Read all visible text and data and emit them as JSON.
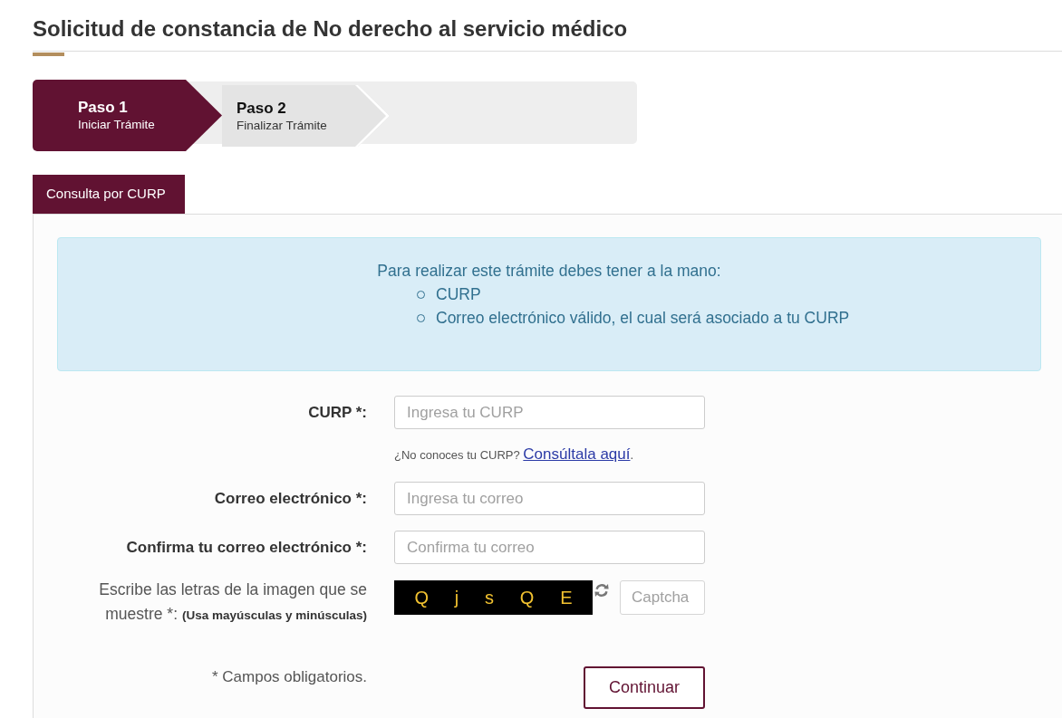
{
  "page": {
    "title": "Solicitud de constancia de No derecho al servicio médico"
  },
  "steps": [
    {
      "label": "Paso 1",
      "sublabel": "Iniciar Trámite",
      "selected": true
    },
    {
      "label": "Paso 2",
      "sublabel": "Finalizar Trámite",
      "selected": false
    }
  ],
  "tabs": [
    {
      "label": "Consulta por CURP",
      "selected": true
    }
  ],
  "notice": {
    "text": "Para realizar este trámite debes tener a la mano:",
    "items": [
      "CURP",
      "Correo electrónico válido, el cual será asociado a tu CURP"
    ]
  },
  "form": {
    "fields": [
      {
        "label": "CURP *:",
        "placeholder": "Ingresa tu CURP",
        "help": {
          "text": "¿No conoces tu CURP?",
          "link": "Consúltala aquí",
          "suffix": "."
        }
      },
      {
        "label": "Correo electrónico *:",
        "placeholder": "Ingresa tu correo"
      },
      {
        "label": "Confirma tu correo electrónico *:",
        "placeholder": "Confirma tu correo"
      }
    ],
    "captcha": {
      "label": "Escribe las letras de la imagen que se muestre *: **(Usa mayúsculas y minúsculas)**",
      "letters": [
        "Q",
        "j",
        "s",
        "Q",
        "E"
      ],
      "placeholder": "Captcha"
    },
    "required_note": "* Campos obligatorios.",
    "submit": {
      "label": "Continuar"
    }
  }
}
